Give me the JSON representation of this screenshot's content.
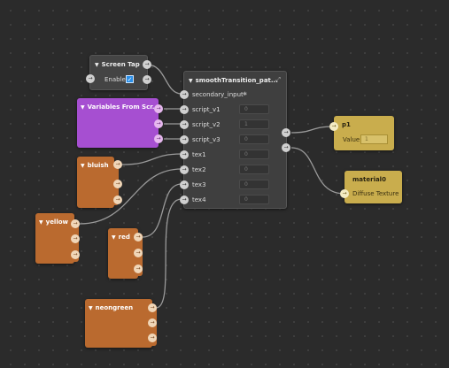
{
  "screen_tap": {
    "title": "Screen Tap",
    "enabled_label": "Enabled",
    "enabled_checked": true
  },
  "smooth_transition": {
    "title": "smoothTransition_pat...",
    "inputs": [
      {
        "label": "secondary_input",
        "value": ""
      },
      {
        "label": "script_v1",
        "value": "0"
      },
      {
        "label": "script_v2",
        "value": "1"
      },
      {
        "label": "script_v3",
        "value": "0"
      },
      {
        "label": "tex1",
        "value": "0"
      },
      {
        "label": "tex2",
        "value": "0"
      },
      {
        "label": "tex3",
        "value": "0"
      },
      {
        "label": "tex4",
        "value": "0"
      }
    ]
  },
  "variables_node": {
    "title": "Variables From Scr..."
  },
  "bluish_node": {
    "title": "bluish"
  },
  "yellow_node": {
    "title": "yellow"
  },
  "red_node": {
    "title": "red"
  },
  "neongreen_node": {
    "title": "neongreen"
  },
  "p1_node": {
    "title": "p1",
    "value_label": "Value",
    "value": "1"
  },
  "material_node": {
    "title": "material0",
    "input_label": "Diffuse Texture"
  },
  "colors": {
    "canvas": "#2b2b2b",
    "patch_node": "#3f3f3f",
    "variables_node": "#a64fd1",
    "texture_node": "#ba6a2f",
    "param_node": "#c9ad4d",
    "wire": "#9a9a9a",
    "checkbox": "#2a8fe8"
  }
}
